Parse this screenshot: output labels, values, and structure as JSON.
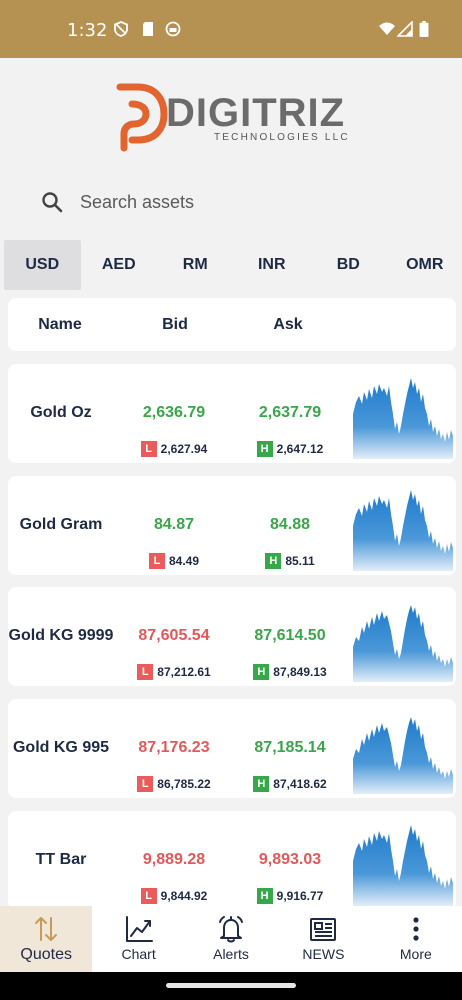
{
  "status_bar": {
    "time": "1:32"
  },
  "brand": {
    "name": "DIGITRIZ",
    "tagline": "TECHNOLOGIES LLC",
    "primary_color": "#e2652f",
    "secondary_color": "#6b6b6b"
  },
  "search": {
    "placeholder": "Search assets",
    "value": ""
  },
  "currency_tabs": {
    "active": "USD",
    "items": [
      "USD",
      "AED",
      "RM",
      "INR",
      "BD",
      "OMR"
    ]
  },
  "table_header": {
    "name": "Name",
    "bid": "Bid",
    "ask": "Ask"
  },
  "badges": {
    "low": "L",
    "high": "H"
  },
  "colors": {
    "up": "#3aa64a",
    "down": "#e3585a",
    "accent": "#b59152",
    "chart": "#2a80c8"
  },
  "quotes": [
    {
      "name": "Gold Oz",
      "bid": "2,636.79",
      "ask": "2,637.79",
      "low": "2,627.94",
      "high": "2,647.12",
      "trend": "up"
    },
    {
      "name": "Gold Gram",
      "bid": "84.87",
      "ask": "84.88",
      "low": "84.49",
      "high": "85.11",
      "trend": "up"
    },
    {
      "name": "Gold KG 9999",
      "bid": "87,605.54",
      "ask": "87,614.50",
      "low": "87,212.61",
      "high": "87,849.13",
      "trend": "mixed"
    },
    {
      "name": "Gold KG 995",
      "bid": "87,176.23",
      "ask": "87,185.14",
      "low": "86,785.22",
      "high": "87,418.62",
      "trend": "mixed"
    },
    {
      "name": "TT Bar",
      "bid": "9,889.28",
      "ask": "9,893.03",
      "low": "9,844.92",
      "high": "9,916.77",
      "trend": "down"
    }
  ],
  "bottom_nav": [
    {
      "label": "Quotes",
      "icon": "sort-arrows-icon",
      "active": true
    },
    {
      "label": "Chart",
      "icon": "chart-icon",
      "active": false
    },
    {
      "label": "Alerts",
      "icon": "bell-icon",
      "active": false
    },
    {
      "label": "NEWS",
      "icon": "newspaper-icon",
      "active": false
    },
    {
      "label": "More",
      "icon": "more-vertical-icon",
      "active": false
    }
  ]
}
